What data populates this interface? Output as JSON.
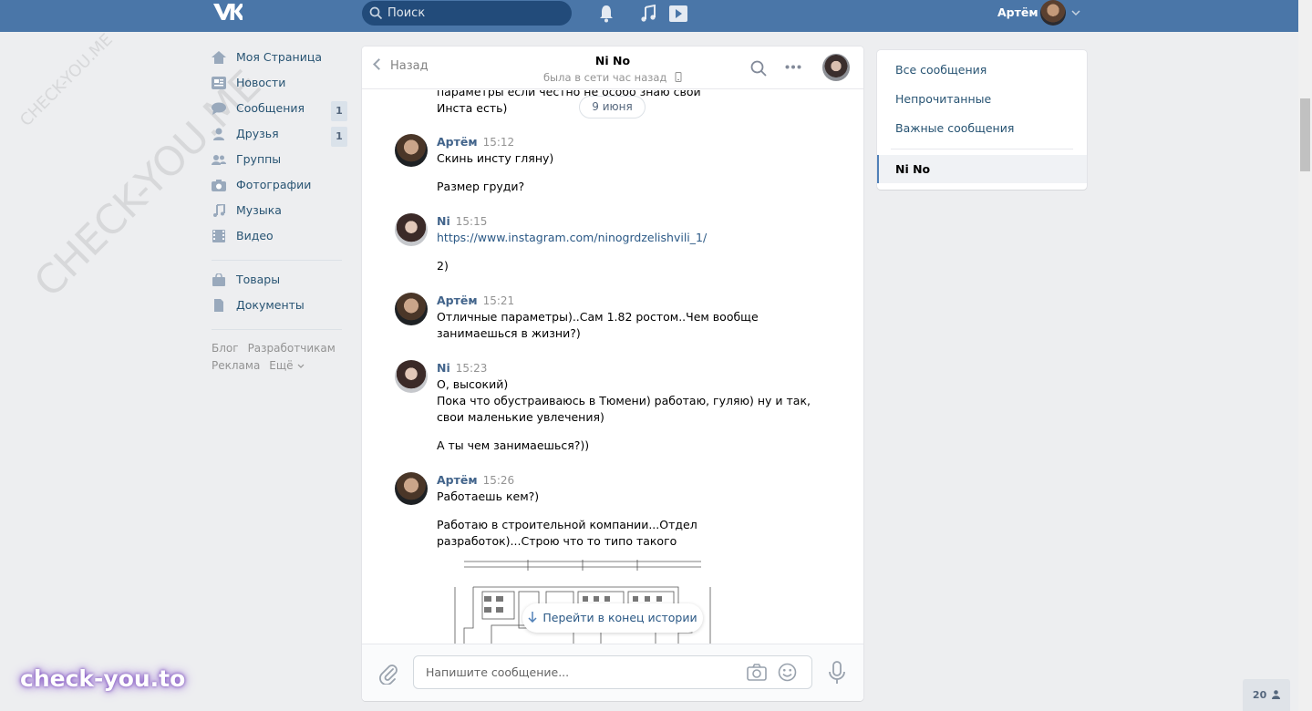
{
  "header": {
    "logo": "vk-logo",
    "search_placeholder": "Поиск",
    "user_name": "Артём"
  },
  "sidebar": {
    "items": [
      {
        "label": "Моя Страница",
        "icon": "home-icon"
      },
      {
        "label": "Новости",
        "icon": "news-icon"
      },
      {
        "label": "Сообщения",
        "icon": "messages-icon",
        "count": "1"
      },
      {
        "label": "Друзья",
        "icon": "friends-icon",
        "count": "1"
      },
      {
        "label": "Группы",
        "icon": "groups-icon"
      },
      {
        "label": "Фотографии",
        "icon": "camera-icon"
      },
      {
        "label": "Музыка",
        "icon": "music-icon"
      },
      {
        "label": "Видео",
        "icon": "video-icon"
      },
      {
        "label": "Товары",
        "icon": "bag-icon"
      },
      {
        "label": "Документы",
        "icon": "document-icon"
      }
    ],
    "footer": {
      "blog": "Блог",
      "developers": "Разработчикам",
      "ads": "Реклама",
      "more": "Ещё"
    }
  },
  "chat": {
    "back_label": "Назад",
    "peer_name": "Ni No",
    "peer_status": "была в сети час назад",
    "date_pill": "9 июня",
    "partial_lines": [
      "параметры если честно не особо знаю свои",
      "Инста есть)"
    ],
    "groups": [
      {
        "author": "Артём",
        "time": "15:12",
        "avatar": "artem",
        "messages": [
          [
            "Скинь инсту гляну)"
          ],
          [
            "Размер груди?"
          ]
        ]
      },
      {
        "author": "Ni",
        "time": "15:15",
        "avatar": "ni",
        "messages": [
          [
            "https://www.instagram.com/ninogrdzelishvili_1/"
          ],
          [
            "2)"
          ]
        ]
      },
      {
        "author": "Артём",
        "time": "15:21",
        "avatar": "artem",
        "messages": [
          [
            "Отличные параметры)..Сам 1.82 ростом..Чем вообще",
            "занимаешься в жизни?)"
          ]
        ]
      },
      {
        "author": "Ni",
        "time": "15:23",
        "avatar": "ni",
        "messages": [
          [
            "О, высокий)",
            "Пока что обустраиваюсь в Тюмени) работаю, гуляю) ну и так,",
            "свои маленькие увлечения)"
          ],
          [
            "А ты чем занимаешься?))"
          ]
        ]
      },
      {
        "author": "Артём",
        "time": "15:26",
        "avatar": "artem",
        "messages": [
          [
            "Работаешь кем?)"
          ],
          [
            "Работаю в строительной компании...Отдел",
            "разработок)...Строю что то типо такого"
          ]
        ]
      }
    ],
    "to_end_label": "Перейти в конец истории",
    "compose_placeholder": "Напишите сообщение..."
  },
  "folders": {
    "all": "Все сообщения",
    "unread": "Непрочитанные",
    "important": "Важные сообщения",
    "active": "Ni No"
  },
  "watermark": "CHECK-YOU.ME",
  "brand": "check-you.to",
  "counter": "20",
  "colors": {
    "header": "#4a76a8",
    "link": "#2a5885",
    "author": "#42648b",
    "bg": "#edeef0"
  }
}
